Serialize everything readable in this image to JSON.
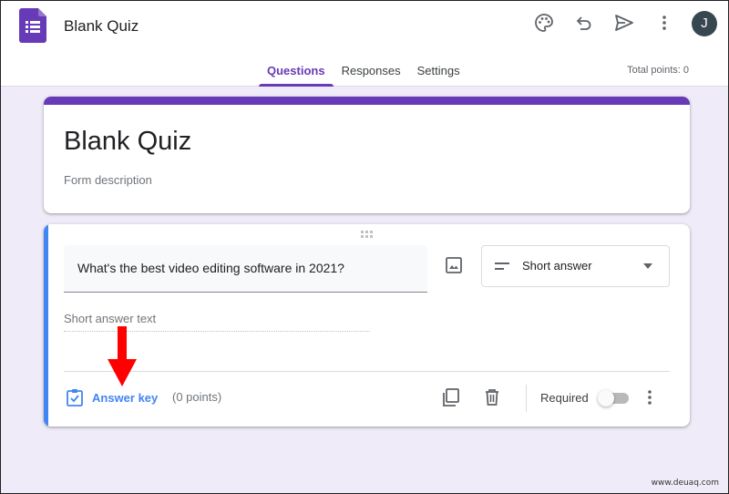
{
  "header": {
    "doc_title": "Blank Quiz",
    "icons": [
      "palette-icon",
      "undo-icon",
      "send-icon",
      "more-vert-icon"
    ],
    "avatar_initial": "J",
    "brand_color": "#673ab7"
  },
  "tabs": [
    {
      "label": "Questions",
      "active": true
    },
    {
      "label": "Responses",
      "active": false
    },
    {
      "label": "Settings",
      "active": false
    }
  ],
  "total_points": "Total points: 0",
  "title_card": {
    "title": "Blank Quiz",
    "description_placeholder": "Form description"
  },
  "question": {
    "text": "What's the best video editing software in 2021?",
    "type": "Short answer",
    "answer_placeholder": "Short answer text",
    "answer_key_label": "Answer key",
    "points": "(0 points)",
    "required_label": "Required",
    "required": false,
    "accent_color": "#4285f4"
  },
  "annotation": {
    "arrow_color": "#ff0000"
  },
  "watermark": "www.deuaq.com"
}
